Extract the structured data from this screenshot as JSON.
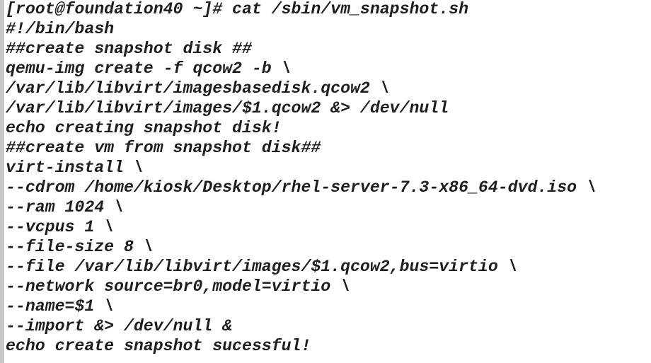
{
  "terminal": {
    "lines": [
      "[root@foundation40 ~]# cat /sbin/vm_snapshot.sh",
      "#!/bin/bash",
      "##create snapshot disk ##",
      "qemu-img create -f qcow2 -b \\",
      "/var/lib/libvirt/imagesbasedisk.qcow2 \\",
      "/var/lib/libvirt/images/$1.qcow2 &> /dev/null",
      "echo creating snapshot disk!",
      "##create vm from snapshot disk##",
      "virt-install \\",
      "--cdrom /home/kiosk/Desktop/rhel-server-7.3-x86_64-dvd.iso \\",
      "--ram 1024 \\",
      "--vcpus 1 \\",
      "--file-size 8 \\",
      "--file /var/lib/libvirt/images/$1.qcow2,bus=virtio \\",
      "--network source=br0,model=virtio \\",
      "--name=$1 \\",
      "--import &> /dev/null &",
      "echo create snapshot sucessful!"
    ]
  }
}
